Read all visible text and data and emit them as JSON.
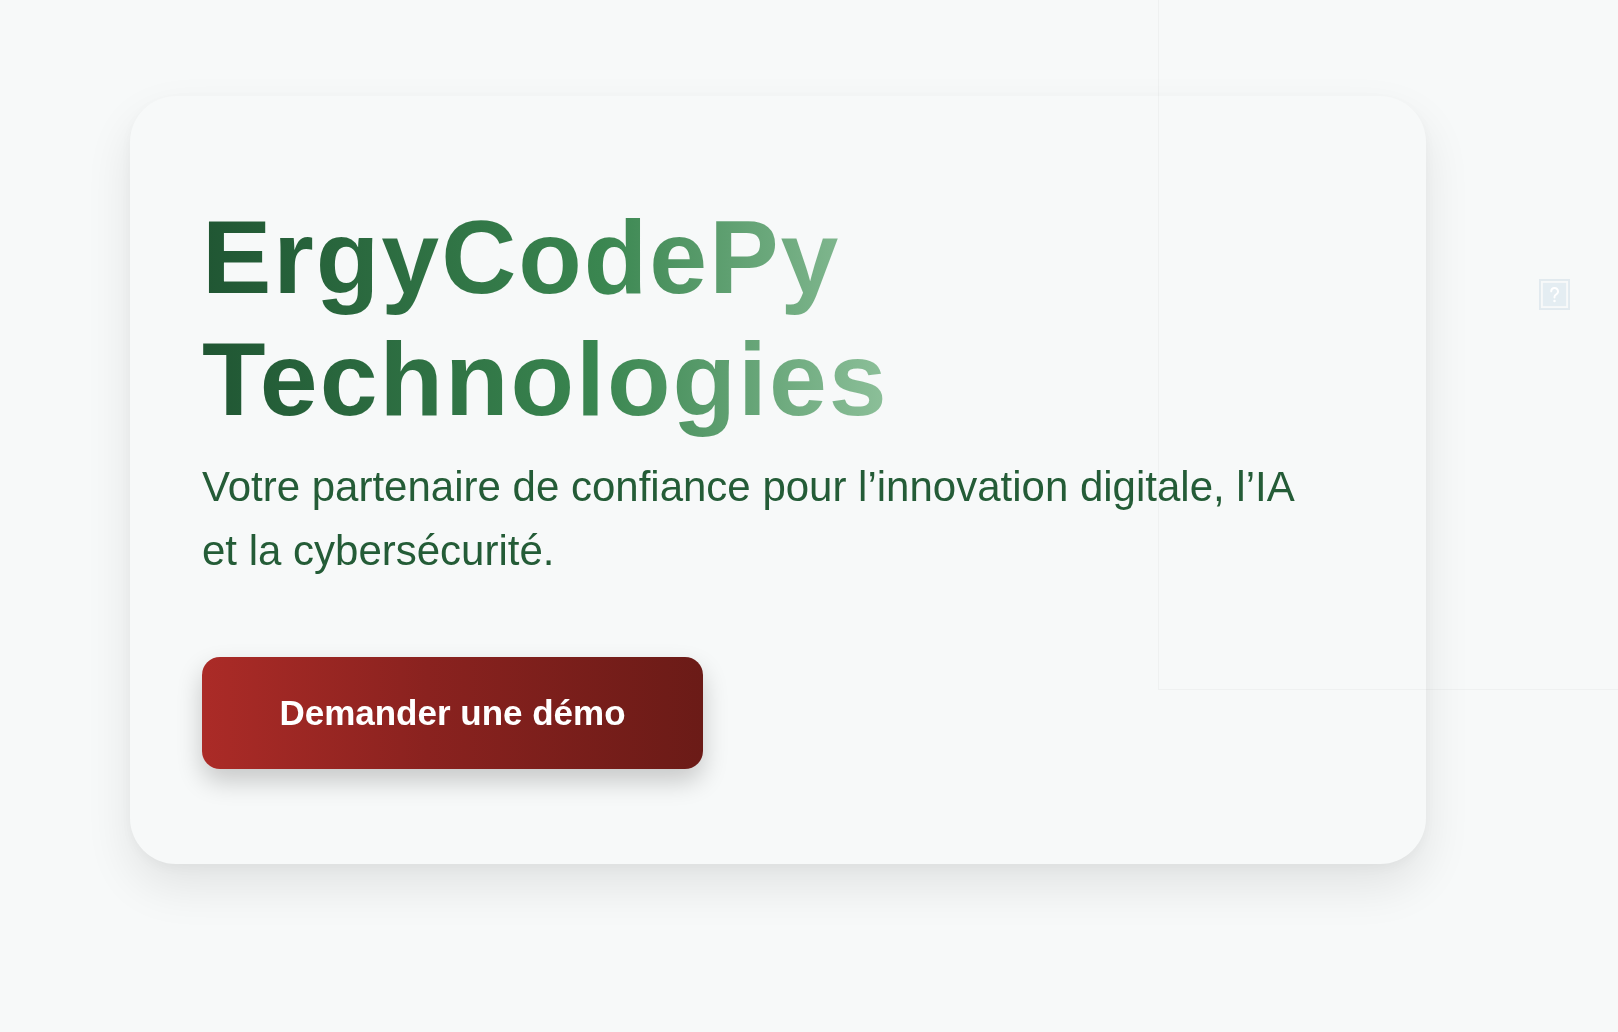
{
  "hero": {
    "title": "ErgyCodePy Technologies",
    "subtitle": "Votre partenaire de confiance pour l’innovation digitale, l’IA et la cybersécurité.",
    "cta_button": "Demander une démo"
  }
}
